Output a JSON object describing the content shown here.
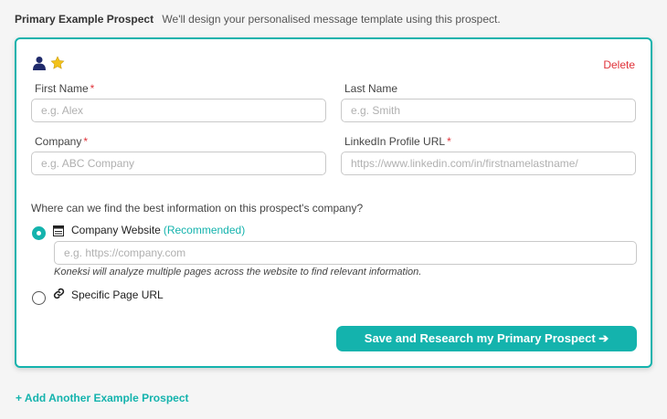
{
  "header": {
    "title": "Primary Example Prospect",
    "subtitle": "We'll design your personalised message template using this prospect."
  },
  "card": {
    "delete_label": "Delete",
    "icons": [
      "user-icon",
      "star-icon"
    ],
    "fields": {
      "first_name": {
        "label": "First Name",
        "required": "*",
        "placeholder": "e.g. Alex",
        "value": ""
      },
      "last_name": {
        "label": "Last Name",
        "placeholder": "e.g. Smith",
        "value": ""
      },
      "company": {
        "label": "Company",
        "required": "*",
        "placeholder": "e.g. ABC Company",
        "value": ""
      },
      "linkedin": {
        "label": "LinkedIn Profile URL",
        "required": "*",
        "placeholder": "https://www.linkedin.com/in/firstnamelastname/",
        "value": ""
      }
    },
    "question": "Where can we find the best information on this prospect's company?",
    "options": {
      "company_website": {
        "label": "Company Website",
        "badge": "(Recommended)",
        "selected": true,
        "placeholder": "e.g. https://company.com",
        "helper": "Koneksi will analyze multiple pages across the website to find relevant information.",
        "icon": "browser-window-icon"
      },
      "specific_page": {
        "label": "Specific Page URL",
        "selected": false,
        "icon": "link-icon"
      }
    },
    "submit_label": "Save and Research my Primary Prospect ➔"
  },
  "add_prospect_label": "+ Add Another Example Prospect",
  "colors": {
    "accent": "#14b3ad",
    "danger": "#e0333a",
    "star": "#f2c21b",
    "user_icon": "#1f2a6b"
  }
}
